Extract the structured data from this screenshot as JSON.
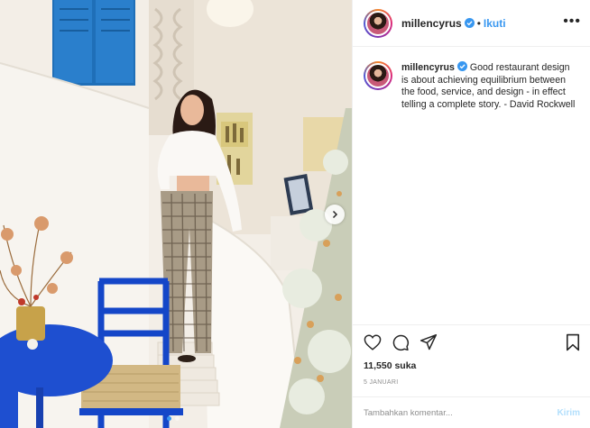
{
  "post": {
    "username": "millencyrus",
    "follow_label": "Ikuti",
    "separator": "•",
    "more_label": "•••",
    "caption": "Good restaurant design is about achieving equilibrium between the food, service, and design - in effect telling a complete story. - David Rockwell",
    "likes": "11,550 suka",
    "date": "5 JANUARI",
    "comment_placeholder": "Tambahkan komentar...",
    "post_label": "Kirim",
    "carousel": {
      "slide_count": 2,
      "active_index": 0
    }
  },
  "colors": {
    "accent": "#3897f0",
    "post_disabled": "#b2dffc",
    "divider": "#efefef",
    "shutter_blue": "#1f6fb8",
    "chair_blue": "#1446c8"
  },
  "icons": {
    "verified": "verified-badge-icon",
    "more": "more-options-icon",
    "like": "heart-icon",
    "comment": "comment-icon",
    "share": "share-icon",
    "save": "bookmark-icon",
    "next": "chevron-right-icon"
  }
}
